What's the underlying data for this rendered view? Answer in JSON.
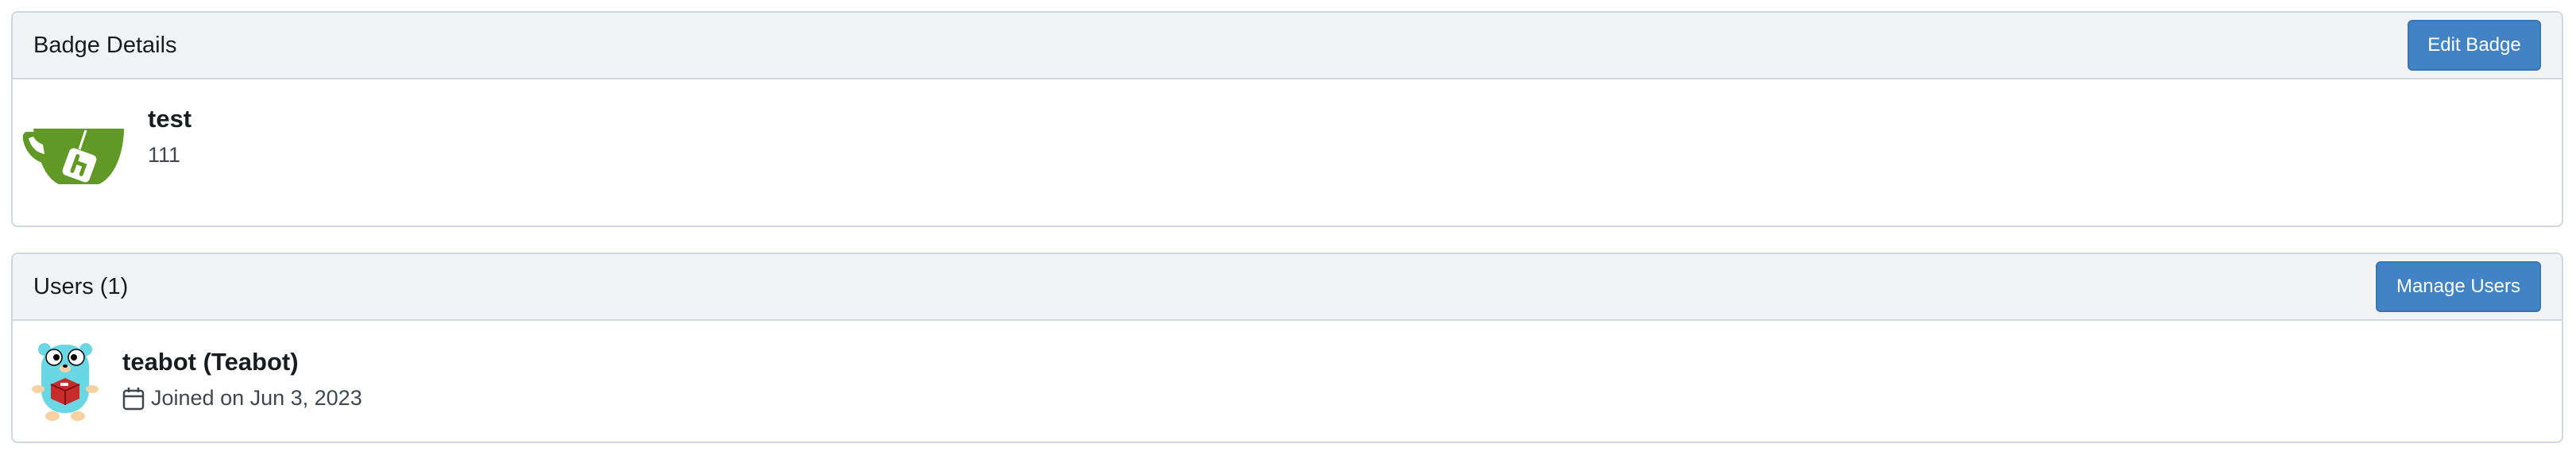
{
  "badge_panel": {
    "title": "Badge Details",
    "edit_button": "Edit Badge",
    "badge": {
      "name": "test",
      "description": "111",
      "icon": "gitea-teacup-logo"
    }
  },
  "users_panel": {
    "title": "Users (1)",
    "manage_button": "Manage Users",
    "users": [
      {
        "display": "teabot (Teabot)",
        "joined": "Joined on Jun 3, 2023",
        "avatar": "gopher-avatar"
      }
    ]
  },
  "colors": {
    "accent": "#4183c4",
    "header_bg": "#f2f3f5",
    "border": "#d0d7de",
    "logo_green": "#609926"
  }
}
